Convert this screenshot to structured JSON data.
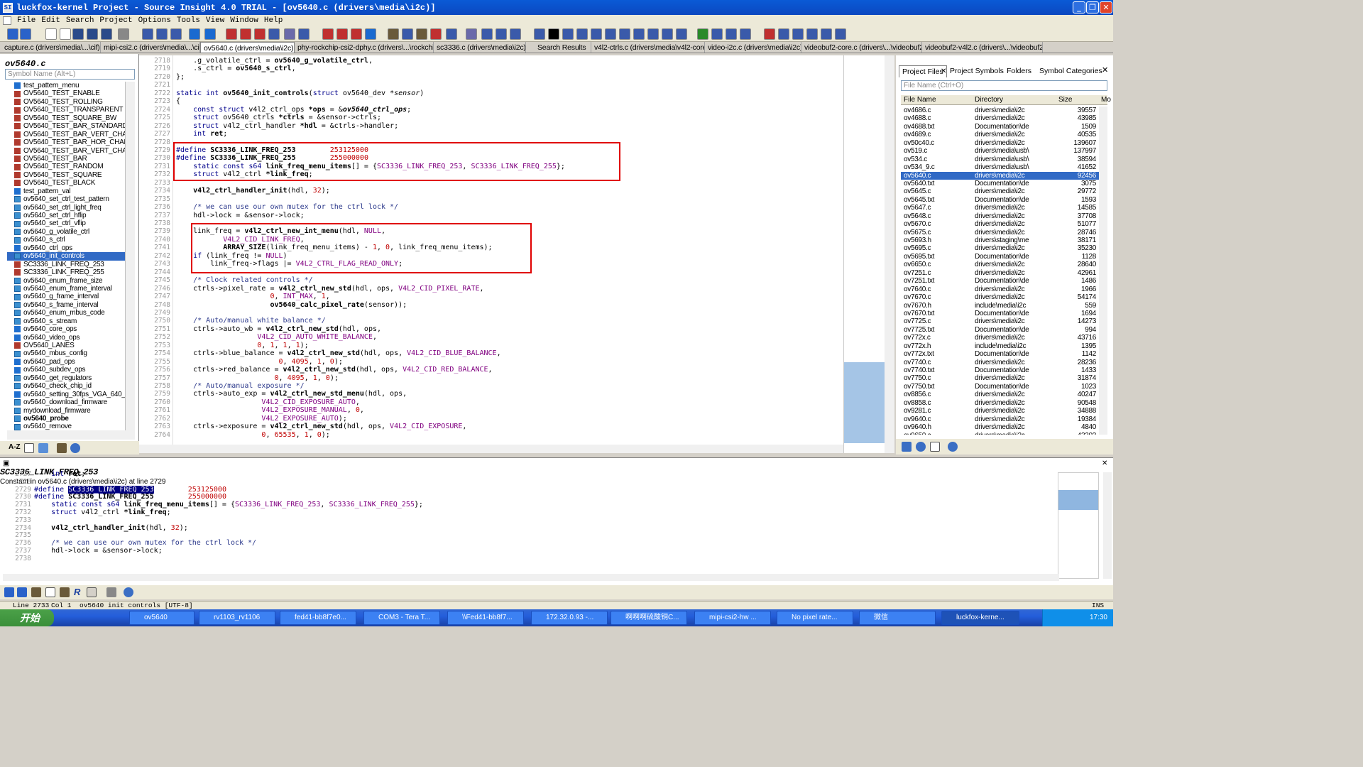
{
  "window": {
    "title": "luckfox-kernel Project - Source Insight 4.0 TRIAL - [ov5640.c (drivers\\media\\i2c)]",
    "min": "_",
    "restore": "❐",
    "close": "✕"
  },
  "menu": [
    "File",
    "Edit",
    "Search",
    "Project",
    "Options",
    "Tools",
    "View",
    "Window",
    "Help"
  ],
  "tabs": [
    "capture.c (drivers\\media\\...\\cif)",
    "mipi-csi2.c (drivers\\media\\...\\cif)",
    "ov5640.c (drivers\\media\\i2c)",
    "phy-rockchip-csi2-dphy.c (drivers\\...\\rockchip)",
    "sc3336.c (drivers\\media\\i2c)",
    "Search Results",
    "v4l2-ctrls.c (drivers\\media\\v4l2-core)",
    "video-i2c.c (drivers\\media\\i2c)",
    "videobuf2-core.c (drivers\\...\\videobuf2)",
    "videobuf2-v4l2.c (drivers\\...\\videobuf2)"
  ],
  "symbol_panel": {
    "title": "ov5640.c",
    "search_placeholder": "Symbol Name (Alt+L)",
    "items": [
      {
        "label": "test_pattern_menu",
        "kind": "c"
      },
      {
        "label": "OV5640_TEST_ENABLE",
        "kind": "d"
      },
      {
        "label": "OV5640_TEST_ROLLING",
        "kind": "d"
      },
      {
        "label": "OV5640_TEST_TRANSPARENT",
        "kind": "d"
      },
      {
        "label": "OV5640_TEST_SQUARE_BW",
        "kind": "d"
      },
      {
        "label": "OV5640_TEST_BAR_STANDARD",
        "kind": "d"
      },
      {
        "label": "OV5640_TEST_BAR_VERT_CHAN",
        "kind": "d"
      },
      {
        "label": "OV5640_TEST_BAR_HOR_CHANG",
        "kind": "d"
      },
      {
        "label": "OV5640_TEST_BAR_VERT_CHAN",
        "kind": "d"
      },
      {
        "label": "OV5640_TEST_BAR",
        "kind": "d"
      },
      {
        "label": "OV5640_TEST_RANDOM",
        "kind": "d"
      },
      {
        "label": "OV5640_TEST_SQUARE",
        "kind": "d"
      },
      {
        "label": "OV5640_TEST_BLACK",
        "kind": "d"
      },
      {
        "label": "test_pattern_val",
        "kind": "c"
      },
      {
        "label": "ov5640_set_ctrl_test_pattern",
        "kind": "f"
      },
      {
        "label": "ov5640_set_ctrl_light_freq",
        "kind": "f"
      },
      {
        "label": "ov5640_set_ctrl_hflip",
        "kind": "f"
      },
      {
        "label": "ov5640_set_ctrl_vflip",
        "kind": "f"
      },
      {
        "label": "ov5640_g_volatile_ctrl",
        "kind": "f"
      },
      {
        "label": "ov5640_s_ctrl",
        "kind": "f"
      },
      {
        "label": "ov5640_ctrl_ops",
        "kind": "c"
      },
      {
        "label": "ov5640_init_controls",
        "kind": "f",
        "selected": true
      },
      {
        "label": "SC3336_LINK_FREQ_253",
        "kind": "d"
      },
      {
        "label": "SC3336_LINK_FREQ_255",
        "kind": "d"
      },
      {
        "label": "ov5640_enum_frame_size",
        "kind": "f"
      },
      {
        "label": "ov5640_enum_frame_interval",
        "kind": "f"
      },
      {
        "label": "ov5640_g_frame_interval",
        "kind": "f"
      },
      {
        "label": "ov5640_s_frame_interval",
        "kind": "f"
      },
      {
        "label": "ov5640_enum_mbus_code",
        "kind": "f"
      },
      {
        "label": "ov5640_s_stream",
        "kind": "f"
      },
      {
        "label": "ov5640_core_ops",
        "kind": "c"
      },
      {
        "label": "ov5640_video_ops",
        "kind": "c"
      },
      {
        "label": "OV5640_LANES",
        "kind": "d"
      },
      {
        "label": "ov5640_mbus_config",
        "kind": "f"
      },
      {
        "label": "ov5640_pad_ops",
        "kind": "c"
      },
      {
        "label": "ov5640_subdev_ops",
        "kind": "c"
      },
      {
        "label": "ov5640_get_regulators",
        "kind": "f"
      },
      {
        "label": "ov5640_check_chip_id",
        "kind": "f"
      },
      {
        "label": "ov5640_setting_30fps_VGA_640_48",
        "kind": "c"
      },
      {
        "label": "ov5640_download_firmware",
        "kind": "f"
      },
      {
        "label": "mydownload_firmware",
        "kind": "f"
      },
      {
        "label": "ov5640_probe",
        "kind": "f",
        "bold": true
      },
      {
        "label": "ov5640_remove",
        "kind": "f"
      }
    ]
  },
  "editor": {
    "lines": [
      {
        "n": "2718",
        "html": "    .g_volatile_ctrl = <b>ov5640_g_volatile_ctrl</b>,"
      },
      {
        "n": "2719",
        "html": "    .s_ctrl = <b>ov5640_s_ctrl</b>,"
      },
      {
        "n": "2720",
        "html": "};"
      },
      {
        "n": "2721",
        "html": ""
      },
      {
        "n": "2722",
        "html": "<span class='kw'>static int</span> <b>ov5640_init_controls</b>(<span class='kw'>struct</span> ov5640_dev <i>*sensor</i>)"
      },
      {
        "n": "2723",
        "html": "{"
      },
      {
        "n": "2724",
        "html": "    <span class='kw'>const struct</span> v4l2_ctrl_ops <b>*ops</b> = &amp;<b><i>ov5640_ctrl_ops</i></b>;"
      },
      {
        "n": "2725",
        "html": "    <span class='kw'>struct</span> ov5640_ctrls <b>*ctrls</b> = &amp;sensor-&gt;ctrls;"
      },
      {
        "n": "2726",
        "html": "    <span class='kw'>struct</span> v4l2_ctrl_handler <b>*hdl</b> = &amp;ctrls-&gt;handler;"
      },
      {
        "n": "2727",
        "html": "    <span class='kw'>int</span> <b>ret</b>;"
      },
      {
        "n": "2728",
        "html": ""
      },
      {
        "n": "2729",
        "html": "<span class='kw'>#define</span> <b>SC3336_LINK_FREQ_253</b>        <span class='num'>253125000</span>"
      },
      {
        "n": "2730",
        "html": "<span class='kw'>#define</span> <b>SC3336_LINK_FREQ_255</b>        <span class='num'>255000000</span>"
      },
      {
        "n": "2731",
        "html": "    <span class='kw'>static const s64</span> <b>link_freq_menu_items</b>[] = {<span class='mac'>SC3336_LINK_FREQ_253</span>, <span class='mac'>SC3336_LINK_FREQ_255</span>};"
      },
      {
        "n": "2732",
        "html": "    <span class='kw'>struct</span> v4l2_ctrl <b>*link_freq</b>;"
      },
      {
        "n": "2733",
        "html": ""
      },
      {
        "n": "2734",
        "html": "    <b>v4l2_ctrl_handler_init</b>(hdl, <span class='num'>32</span>);"
      },
      {
        "n": "2735",
        "html": ""
      },
      {
        "n": "2736",
        "html": "    <span class='cm'>/* we can use our own mutex for the ctrl lock */</span>"
      },
      {
        "n": "2737",
        "html": "    hdl-&gt;lock = &amp;sensor-&gt;lock;"
      },
      {
        "n": "2738",
        "html": ""
      },
      {
        "n": "2739",
        "html": "    link_freq = <b>v4l2_ctrl_new_int_menu</b>(hdl, <span class='mac'>NULL</span>,"
      },
      {
        "n": "2740",
        "html": "           <span class='mac'>V4L2_CID_LINK_FREQ</span>,"
      },
      {
        "n": "2741",
        "html": "           <b>ARRAY_SIZE</b>(link_freq_menu_items) - <span class='num'>1</span>, <span class='num'>0</span>, link_freq_menu_items);"
      },
      {
        "n": "2742",
        "html": "    <span class='kw'>if</span> (link_freq != <span class='mac'>NULL</span>)"
      },
      {
        "n": "2743",
        "html": "        link_freq-&gt;flags |= <span class='mac'>V4L2_CTRL_FLAG_READ_ONLY</span>;"
      },
      {
        "n": "2744",
        "html": ""
      },
      {
        "n": "2745",
        "html": "    <span class='cm'>/* Clock related controls */</span>"
      },
      {
        "n": "2746",
        "html": "    ctrls-&gt;pixel_rate = <b>v4l2_ctrl_new_std</b>(hdl, ops, <span class='mac'>V4L2_CID_PIXEL_RATE</span>,"
      },
      {
        "n": "2747",
        "html": "                      <span class='num'>0</span>, <span class='mac'>INT_MAX</span>, <span class='num'>1</span>,"
      },
      {
        "n": "2748",
        "html": "                      <b>ov5640_calc_pixel_rate</b>(sensor));"
      },
      {
        "n": "2749",
        "html": ""
      },
      {
        "n": "2750",
        "html": "    <span class='cm'>/* Auto/manual white balance */</span>"
      },
      {
        "n": "2751",
        "html": "    ctrls-&gt;auto_wb = <b>v4l2_ctrl_new_std</b>(hdl, ops,"
      },
      {
        "n": "2752",
        "html": "                   <span class='mac'>V4L2_CID_AUTO_WHITE_BALANCE</span>,"
      },
      {
        "n": "2753",
        "html": "                   <span class='num'>0</span>, <span class='num'>1</span>, <span class='num'>1</span>, <span class='num'>1</span>);"
      },
      {
        "n": "2754",
        "html": "    ctrls-&gt;blue_balance = <b>v4l2_ctrl_new_std</b>(hdl, ops, <span class='mac'>V4L2_CID_BLUE_BALANCE</span>,"
      },
      {
        "n": "2755",
        "html": "                        <span class='num'>0</span>, <span class='num'>4095</span>, <span class='num'>1</span>, <span class='num'>0</span>);"
      },
      {
        "n": "2756",
        "html": "    ctrls-&gt;red_balance = <b>v4l2_ctrl_new_std</b>(hdl, ops, <span class='mac'>V4L2_CID_RED_BALANCE</span>,"
      },
      {
        "n": "2757",
        "html": "                       <span class='num'>0</span>, <span class='num'>4095</span>, <span class='num'>1</span>, <span class='num'>0</span>);"
      },
      {
        "n": "2758",
        "html": "    <span class='cm'>/* Auto/manual exposure */</span>"
      },
      {
        "n": "2759",
        "html": "    ctrls-&gt;auto_exp = <b>v4l2_ctrl_new_std_menu</b>(hdl, ops,"
      },
      {
        "n": "2760",
        "html": "                    <span class='mac'>V4L2_CID_EXPOSURE_AUTO</span>,"
      },
      {
        "n": "2761",
        "html": "                    <span class='mac'>V4L2_EXPOSURE_MANUAL</span>, <span class='num'>0</span>,"
      },
      {
        "n": "2762",
        "html": "                    <span class='mac'>V4L2_EXPOSURE_AUTO</span>);"
      },
      {
        "n": "2763",
        "html": "    ctrls-&gt;exposure = <b>v4l2_ctrl_new_std</b>(hdl, ops, <span class='mac'>V4L2_CID_EXPOSURE</span>,"
      },
      {
        "n": "2764",
        "html": "                    <span class='num'>0</span>, <span class='num'>65535</span>, <span class='num'>1</span>, <span class='num'>0</span>);"
      }
    ]
  },
  "project_panel": {
    "tabs": [
      "Project Files",
      "Project Symbols",
      "Folders",
      "Symbol Categories"
    ],
    "search_placeholder": "File Name (Ctrl+O)",
    "columns": [
      "File Name",
      "Directory",
      "Size",
      "Mo"
    ],
    "files": [
      [
        "ov4686.c",
        "drivers\\media\\i2c",
        "39557"
      ],
      [
        "ov4688.c",
        "drivers\\media\\i2c",
        "43985"
      ],
      [
        "ov4688.txt",
        "Documentation\\de",
        "1509"
      ],
      [
        "ov4689.c",
        "drivers\\media\\i2c",
        "40535"
      ],
      [
        "ov50c40.c",
        "drivers\\media\\i2c",
        "139607"
      ],
      [
        "ov519.c",
        "drivers\\media\\usb\\",
        "137997"
      ],
      [
        "ov534.c",
        "drivers\\media\\usb\\",
        "38594"
      ],
      [
        "ov534_9.c",
        "drivers\\media\\usb\\",
        "41652"
      ],
      [
        "ov5640.c",
        "drivers\\media\\i2c",
        "92456",
        "sel"
      ],
      [
        "ov5640.txt",
        "Documentation\\de",
        "3075"
      ],
      [
        "ov5645.c",
        "drivers\\media\\i2c",
        "29772"
      ],
      [
        "ov5645.txt",
        "Documentation\\de",
        "1593"
      ],
      [
        "ov5647.c",
        "drivers\\media\\i2c",
        "14585"
      ],
      [
        "ov5648.c",
        "drivers\\media\\i2c",
        "37708"
      ],
      [
        "ov5670.c",
        "drivers\\media\\i2c",
        "51077"
      ],
      [
        "ov5675.c",
        "drivers\\media\\i2c",
        "28746"
      ],
      [
        "ov5693.h",
        "drivers\\staging\\me",
        "38171"
      ],
      [
        "ov5695.c",
        "drivers\\media\\i2c",
        "35230"
      ],
      [
        "ov5695.txt",
        "Documentation\\de",
        "1128"
      ],
      [
        "ov6650.c",
        "drivers\\media\\i2c",
        "28640"
      ],
      [
        "ov7251.c",
        "drivers\\media\\i2c",
        "42961"
      ],
      [
        "ov7251.txt",
        "Documentation\\de",
        "1486"
      ],
      [
        "ov7640.c",
        "drivers\\media\\i2c",
        "1966"
      ],
      [
        "ov7670.c",
        "drivers\\media\\i2c",
        "54174"
      ],
      [
        "ov7670.h",
        "include\\media\\i2c",
        "559"
      ],
      [
        "ov7670.txt",
        "Documentation\\de",
        "1694"
      ],
      [
        "ov7725.c",
        "drivers\\media\\i2c",
        "14273"
      ],
      [
        "ov7725.txt",
        "Documentation\\de",
        "994"
      ],
      [
        "ov772x.c",
        "drivers\\media\\i2c",
        "43716"
      ],
      [
        "ov772x.h",
        "include\\media\\i2c",
        "1395"
      ],
      [
        "ov772x.txt",
        "Documentation\\de",
        "1142"
      ],
      [
        "ov7740.c",
        "drivers\\media\\i2c",
        "28236"
      ],
      [
        "ov7740.txt",
        "Documentation\\de",
        "1433"
      ],
      [
        "ov7750.c",
        "drivers\\media\\i2c",
        "31874"
      ],
      [
        "ov7750.txt",
        "Documentation\\de",
        "1023"
      ],
      [
        "ov8856.c",
        "drivers\\media\\i2c",
        "40247"
      ],
      [
        "ov8858.c",
        "drivers\\media\\i2c",
        "90548"
      ],
      [
        "ov9281.c",
        "drivers\\media\\i2c",
        "34888"
      ],
      [
        "ov9640.c",
        "drivers\\media\\i2c",
        "19384"
      ],
      [
        "ov9640.h",
        "drivers\\media\\i2c",
        "4840"
      ],
      [
        "ov9650.c",
        "drivers\\media\\i2c",
        "43303"
      ]
    ]
  },
  "context": {
    "symbol": "SC3336_LINK_FREQ_253",
    "desc": "Constant in ov5640.c (drivers\\media\\i2c) at line 2729",
    "lines": [
      {
        "n": "2727",
        "html": "    <span class='kw'>int</span> <b>ret</b>;"
      },
      {
        "n": "2728",
        "html": ""
      },
      {
        "n": "2729",
        "html": "<span class='kw'>#define</span> <span class='hl'>SC3336_LINK_FREQ_253</span>        <span class='num'>253125000</span>"
      },
      {
        "n": "2730",
        "html": "<span class='kw'>#define</span> <b>SC3336_LINK_FREQ_255</b>        <span class='num'>255000000</span>"
      },
      {
        "n": "2731",
        "html": "    <span class='kw'>static const s64</span> <b>link_freq_menu_items</b>[] = {<span class='mac'>SC3336_LINK_FREQ_253</span>, <span class='mac'>SC3336_LINK_FREQ_255</span>};"
      },
      {
        "n": "2732",
        "html": "    <span class='kw'>struct</span> v4l2_ctrl <b>*link_freq</b>;"
      },
      {
        "n": "2733",
        "html": ""
      },
      {
        "n": "2734",
        "html": "    <b>v4l2_ctrl_handler_init</b>(hdl, <span class='num'>32</span>);"
      },
      {
        "n": "2735",
        "html": ""
      },
      {
        "n": "2736",
        "html": "    <span class='cm'>/* we can use our own mutex for the ctrl lock */</span>"
      },
      {
        "n": "2737",
        "html": "    hdl-&gt;lock = &amp;sensor-&gt;lock;"
      },
      {
        "n": "2738",
        "html": ""
      }
    ]
  },
  "status": {
    "line": "Line 2733",
    "col": "Col 1",
    "symbol": "ov5640 init controls [UTF-8]",
    "mode": "INS"
  },
  "taskbar": {
    "start": "开始",
    "tasks": [
      "ov5640",
      "rv1103_rv1106",
      "fed41-bb8f7e0...",
      "COM3 - Tera T...",
      "\\\\Fed41-bb8f7...",
      "172.32.0.93 -...",
      "啊啊啊硫酸铜C...",
      "mipi-csi2-hw ...",
      "No pixel rate...",
      "微信",
      "luckfox-kerne..."
    ],
    "clock": "17:30"
  },
  "colors": {
    "accent": "#316ac5",
    "box": "#e00000"
  }
}
